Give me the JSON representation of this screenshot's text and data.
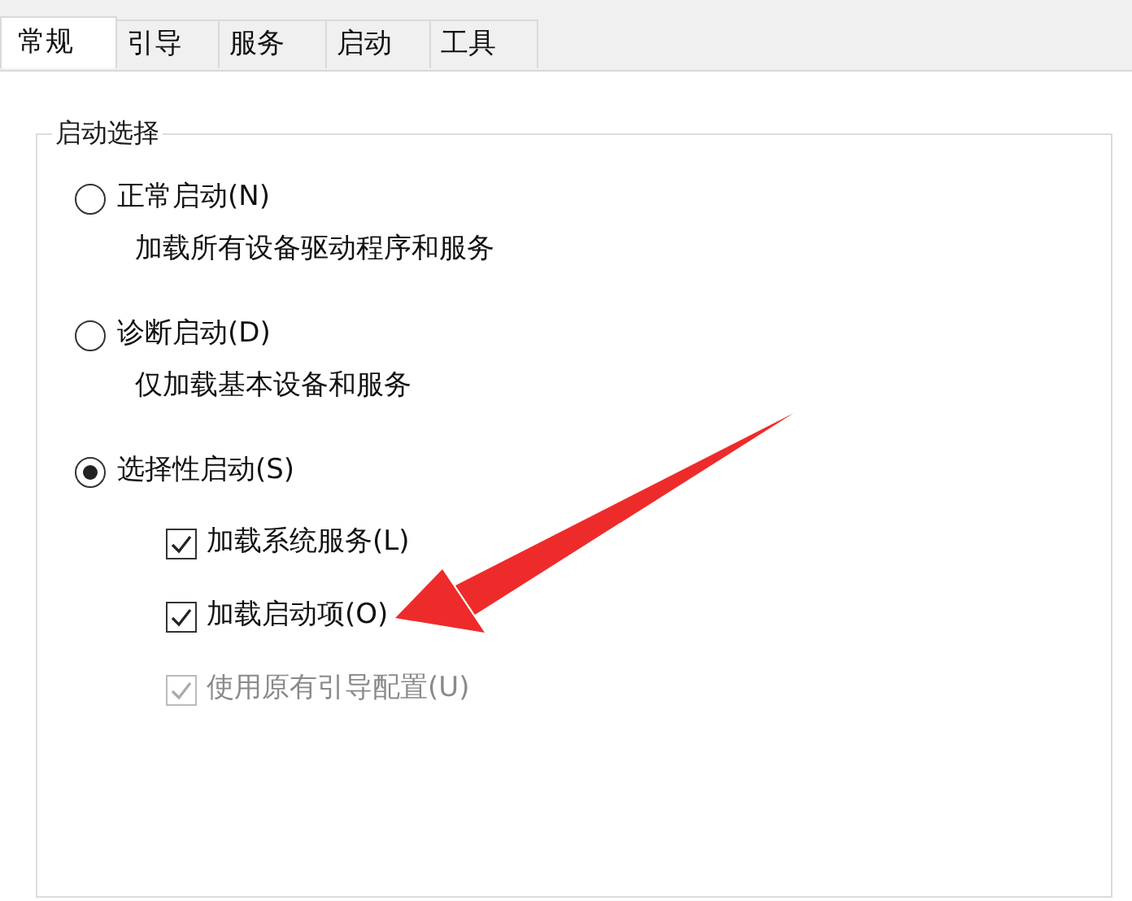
{
  "tabs": [
    {
      "label": "常规",
      "selected": true
    },
    {
      "label": "引导",
      "selected": false
    },
    {
      "label": "服务",
      "selected": false
    },
    {
      "label": "启动",
      "selected": false
    },
    {
      "label": "工具",
      "selected": false
    }
  ],
  "group": {
    "title": "启动选择",
    "options": [
      {
        "label": "正常启动(N)",
        "selected": false,
        "description": "加载所有设备驱动程序和服务"
      },
      {
        "label": "诊断启动(D)",
        "selected": false,
        "description": "仅加载基本设备和服务"
      },
      {
        "label": "选择性启动(S)",
        "selected": true,
        "checkboxes": [
          {
            "label": "加载系统服务(L)",
            "checked": true,
            "disabled": false
          },
          {
            "label": "加载启动项(O)",
            "checked": true,
            "disabled": false
          },
          {
            "label": "使用原有引导配置(U)",
            "checked": true,
            "disabled": true
          }
        ]
      }
    ]
  },
  "annotation": {
    "kind": "arrow"
  }
}
